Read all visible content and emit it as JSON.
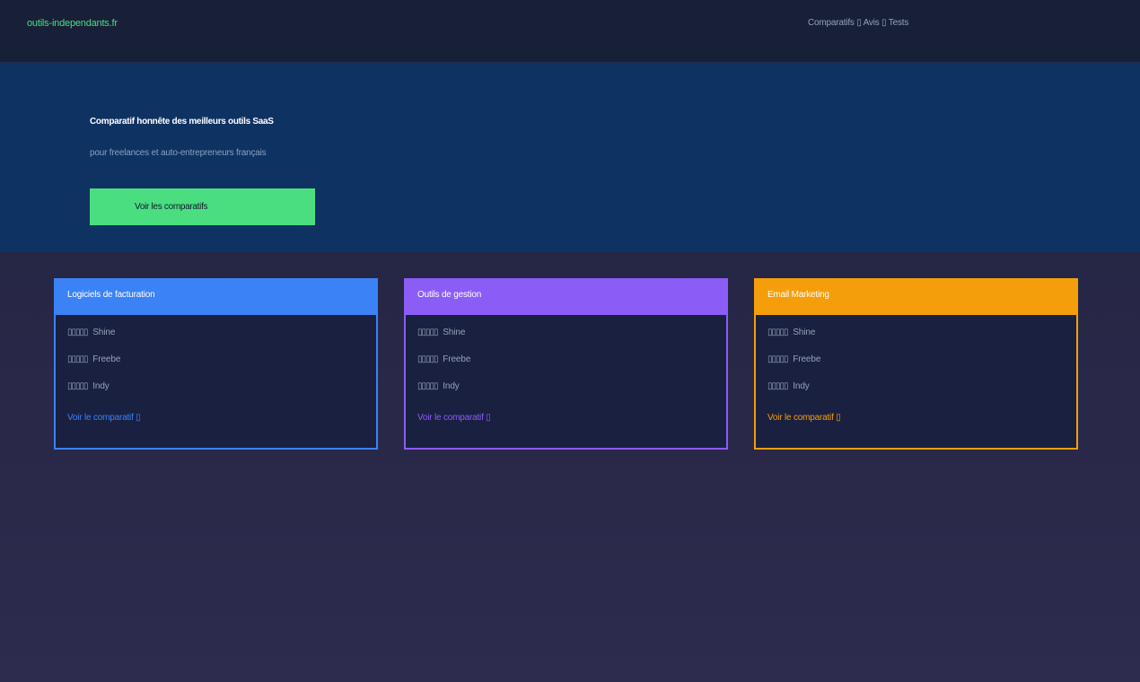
{
  "header": {
    "brand": "outils-independants.fr",
    "nav": "Comparatifs ▯ Avis ▯ Tests"
  },
  "hero": {
    "title": "Comparatif honnête des meilleurs outils SaaS",
    "subtitle": "pour freelances et auto-entrepreneurs français",
    "cta_label": "Voir les comparatifs"
  },
  "cards": [
    {
      "title": "Logiciels de facturation",
      "items": [
        {
          "stars": "▯▯▯▯▯",
          "name": "Shine"
        },
        {
          "stars": "▯▯▯▯▯",
          "name": "Freebe"
        },
        {
          "stars": "▯▯▯▯▯",
          "name": "Indy"
        }
      ],
      "link_label": "Voir le comparatif ▯"
    },
    {
      "title": "Outils de gestion",
      "items": [
        {
          "stars": "▯▯▯▯▯",
          "name": "Shine"
        },
        {
          "stars": "▯▯▯▯▯",
          "name": "Freebe"
        },
        {
          "stars": "▯▯▯▯▯",
          "name": "Indy"
        }
      ],
      "link_label": "Voir le comparatif ▯"
    },
    {
      "title": "Email Marketing",
      "items": [
        {
          "stars": "▯▯▯▯▯",
          "name": "Shine"
        },
        {
          "stars": "▯▯▯▯▯",
          "name": "Freebe"
        },
        {
          "stars": "▯▯▯▯▯",
          "name": "Indy"
        }
      ],
      "link_label": "Voir le comparatif ▯"
    }
  ],
  "colors": {
    "brand_green": "#4ade80",
    "card_blue": "#3b82f6",
    "card_purple": "#8b5cf6",
    "card_orange": "#f59e0b",
    "hero_bg": "#0e3262",
    "topbar_bg": "#182038"
  }
}
